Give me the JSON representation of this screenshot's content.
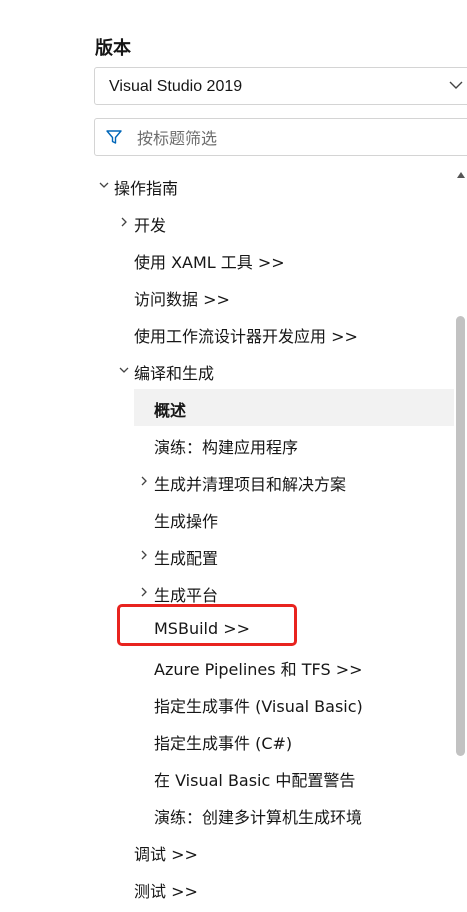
{
  "version": {
    "label": "版本",
    "selected": "Visual Studio 2019",
    "chevron_icon": "chevron-down-icon"
  },
  "filter": {
    "placeholder": "按标题筛选",
    "icon": "filter-funnel-icon"
  },
  "colors": {
    "text": "#161616",
    "selected_background": "#f2f2f2",
    "callout_border": "#e8231f",
    "scrollbar_thumb": "#c2c2c2",
    "filter_icon": "#0066b8"
  },
  "tree": {
    "items": [
      {
        "label": "操作指南",
        "toggle": "expanded"
      },
      {
        "label": "开发",
        "toggle": "collapsed"
      },
      {
        "label": "使用 XAML 工具 >>",
        "toggle": "none"
      },
      {
        "label": "访问数据 >>",
        "toggle": "none"
      },
      {
        "label": "使用工作流设计器开发应用 >>",
        "toggle": "none"
      },
      {
        "label": "编译和生成",
        "toggle": "expanded"
      },
      {
        "label": "概述",
        "toggle": "none",
        "selected": true
      },
      {
        "label": "演练：构建应用程序",
        "toggle": "none"
      },
      {
        "label": "生成并清理项目和解决方案",
        "toggle": "collapsed"
      },
      {
        "label": "生成操作",
        "toggle": "none"
      },
      {
        "label": "生成配置",
        "toggle": "collapsed"
      },
      {
        "label": "生成平台",
        "toggle": "collapsed"
      },
      {
        "label": "MSBuild >>",
        "toggle": "none",
        "highlighted": true
      },
      {
        "label": "Azure Pipelines 和 TFS >>",
        "toggle": "none"
      },
      {
        "label": "指定生成事件 (Visual Basic)",
        "toggle": "none"
      },
      {
        "label": "指定生成事件 (C#)",
        "toggle": "none"
      },
      {
        "label": "在 Visual Basic 中配置警告",
        "toggle": "none"
      },
      {
        "label": "演练：创建多计算机生成环境",
        "toggle": "none"
      },
      {
        "label": "调试 >>",
        "toggle": "none"
      },
      {
        "label": "测试 >>",
        "toggle": "none"
      }
    ]
  }
}
